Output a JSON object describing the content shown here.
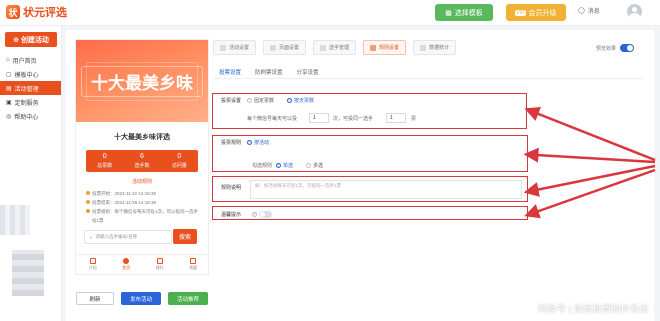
{
  "header": {
    "logo_mark": "状",
    "logo_text": "状元评选",
    "template_button": "选择模板",
    "vip_button": "会员升级",
    "vip_badge": "VIP",
    "messages_label": "消息"
  },
  "sidebar": {
    "create_button": "创建活动",
    "items": [
      {
        "label": "用户首页",
        "icon": "home-icon"
      },
      {
        "label": "模板中心",
        "icon": "template-icon"
      },
      {
        "label": "活动管理",
        "icon": "activity-icon"
      },
      {
        "label": "定制服务",
        "icon": "service-icon"
      },
      {
        "label": "帮助中心",
        "icon": "help-icon"
      }
    ],
    "active_index": 2
  },
  "preview": {
    "banner_title": "十大最美乡味",
    "activity_name": "十大最美乡味评选",
    "stats": [
      {
        "value": "0",
        "label": "总票数"
      },
      {
        "value": "6",
        "label": "选手数"
      },
      {
        "value": "0",
        "label": "访问量"
      }
    ],
    "intro_heading": "活动规则",
    "info_lines": [
      "投票开始：2024-11-22 14:18:39",
      "投票结束：2024-11-29 14:18:39",
      "投票规则：每个微信号每天可投1次，可以投同一选手投1票"
    ],
    "search_placeholder": "请输入选手编号/名称",
    "search_button": "搜索",
    "bottom_nav": [
      "介绍",
      "首页",
      "排行",
      "我要"
    ]
  },
  "actions": {
    "refresh": "刷新",
    "publish": "发布活动",
    "preview": "活动推荐"
  },
  "tabs": [
    {
      "label": "活动设置",
      "active": false
    },
    {
      "label": "页面设置",
      "active": false
    },
    {
      "label": "选手管理",
      "active": false
    },
    {
      "label": "规则设置",
      "active": true
    },
    {
      "label": "数据统计",
      "active": false
    }
  ],
  "preview_toggle_label": "预览效果",
  "subtabs": [
    {
      "label": "投票设置",
      "active": true
    },
    {
      "label": "防刷票设置",
      "active": false
    },
    {
      "label": "分享设置",
      "active": false
    }
  ],
  "vote_settings": {
    "vote_rule_label": "投票设置",
    "option_fixed": "固定票数",
    "option_daily": "按天票数",
    "daily_line_prefix": "每个微信号每天可以投",
    "daily_count": "1",
    "daily_unit": "次，可投同一选手",
    "same_count": "1",
    "same_unit": "票"
  },
  "vote_mode": {
    "label": "投票规则",
    "option_activity": "按活动",
    "select_label": "勾选规则",
    "option_single": "单选",
    "option_multi": "多选"
  },
  "rule_desc": {
    "label": "规则说明",
    "placeholder": "如：按活动每天可投1次，可投同一选手1票"
  },
  "reminder": {
    "label": "温馨提示",
    "help": "?"
  },
  "watermark": "网易号 | 微信投票制作系统"
}
